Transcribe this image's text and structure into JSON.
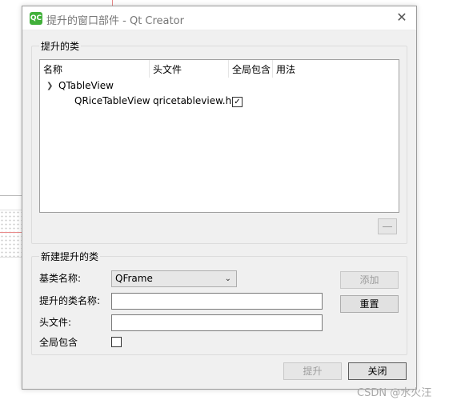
{
  "window": {
    "icon_text": "QC",
    "title": "提升的窗口部件 - Qt Creator"
  },
  "promoted_group": {
    "title": "提升的类",
    "columns": [
      "名称",
      "头文件",
      "全局包含",
      "用法"
    ],
    "parent_item": "QTableView",
    "child_item": {
      "name": "QRiceTableView",
      "header": "qricetableview.h",
      "global_include_checked": true,
      "usage": ""
    }
  },
  "new_group": {
    "title": "新建提升的类",
    "base_class_label": "基类名称:",
    "base_class_value": "QFrame",
    "class_name_label": "提升的类名称:",
    "class_name_value": "",
    "header_label": "头文件:",
    "header_value": "",
    "global_include_label": "全局包含",
    "global_include_checked": false,
    "add_label": "添加",
    "reset_label": "重置"
  },
  "footer": {
    "promote_label": "提升",
    "close_label": "关闭"
  },
  "watermark": "CSDN @水火汪"
}
